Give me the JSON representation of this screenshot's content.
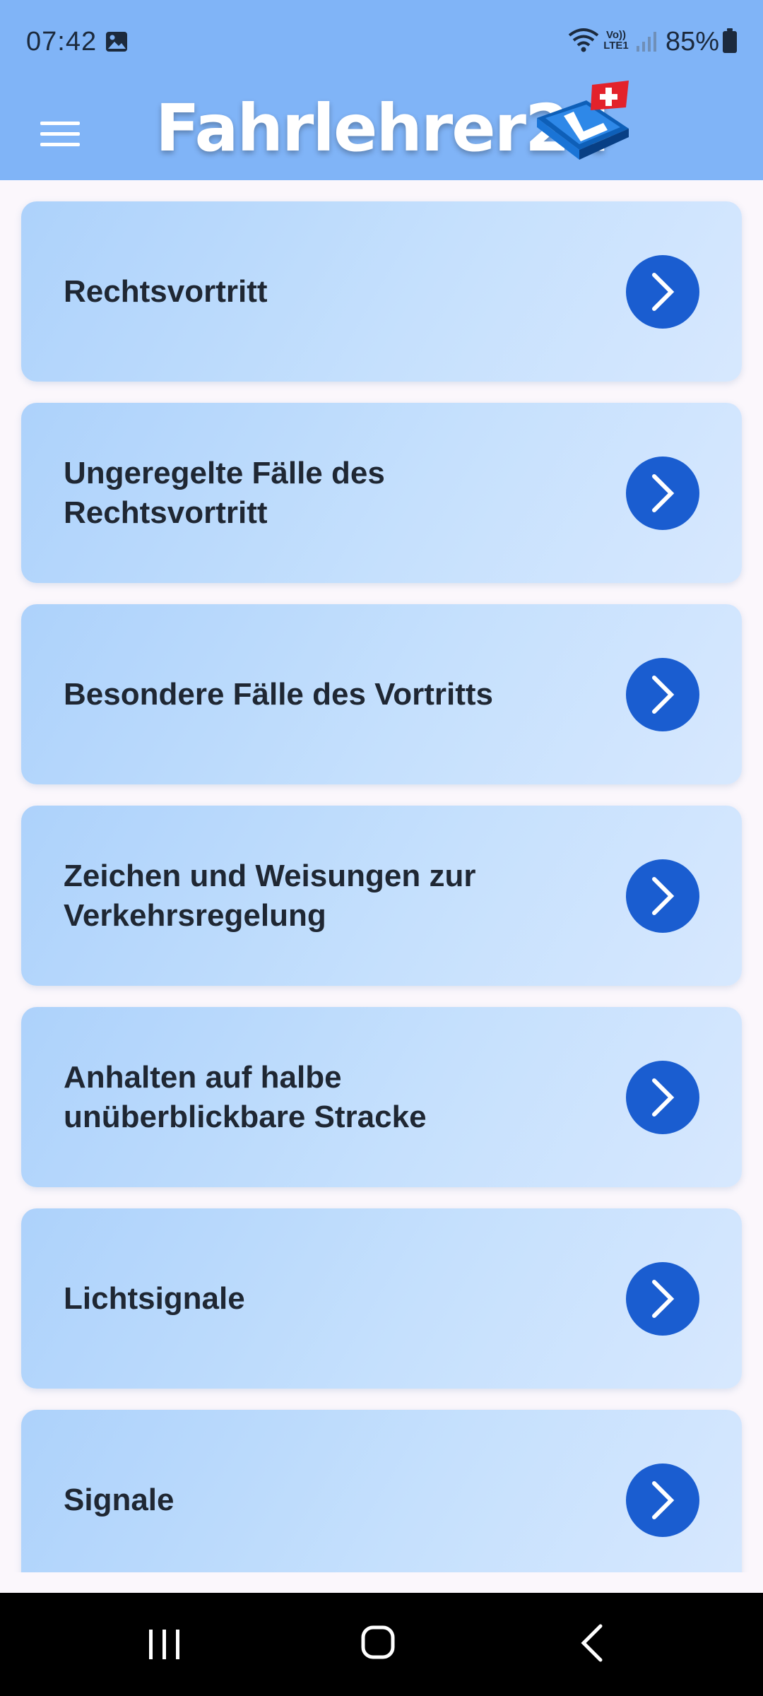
{
  "status_bar": {
    "time": "07:42",
    "volte_line1": "Vo))",
    "volte_line2": "LTE1",
    "battery": "85%",
    "icons": [
      "gallery-icon",
      "wifi-icon",
      "volte-icon",
      "signal-icon",
      "battery-icon"
    ]
  },
  "app_bar": {
    "title": "Fahrlehrer24",
    "menu_icon": "hamburger-menu-icon",
    "logo": "l-plate-swiss-flag-logo"
  },
  "topics": [
    {
      "label": "Rechtsvortritt"
    },
    {
      "label": "Ungeregelte Fälle des Rechtsvortritt"
    },
    {
      "label": "Besondere Fälle des Vortritts"
    },
    {
      "label": "Zeichen und Weisungen zur Verkehrsregelung"
    },
    {
      "label": "Anhalten auf halbe unüberblickbare Stracke"
    },
    {
      "label": "Lichtsignale"
    },
    {
      "label": "Signale"
    }
  ],
  "nav_bar": {
    "icons": [
      "recents-icon",
      "home-icon",
      "back-icon"
    ]
  },
  "colors": {
    "header": "#80b4f7",
    "card_start": "#add2fb",
    "card_end": "#d7e8fe",
    "arrow_button": "#1a5dd0",
    "text": "#1f2733"
  }
}
